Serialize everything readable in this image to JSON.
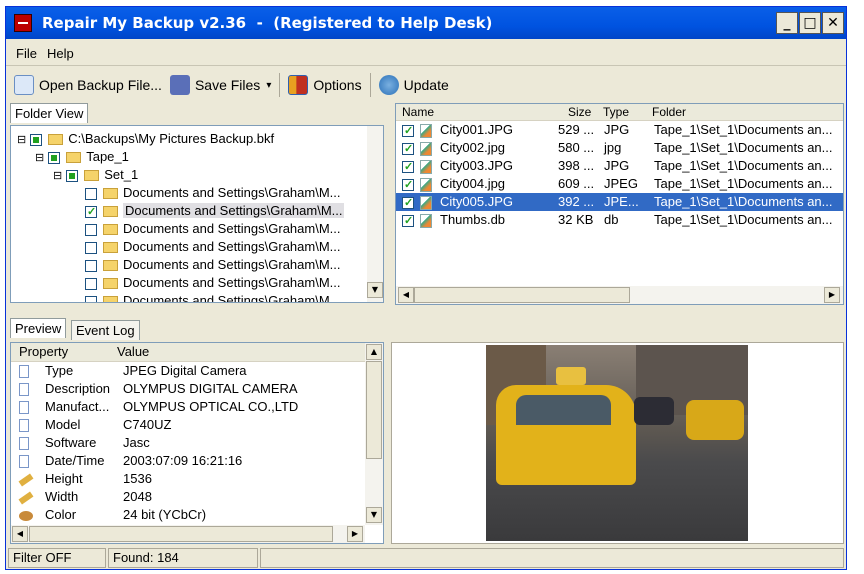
{
  "window": {
    "title": "Repair My Backup v2.36  -  (Registered to Help Desk)",
    "minimize": "_",
    "maximize": "□",
    "close": "✕"
  },
  "menu": [
    "File",
    "Help"
  ],
  "toolbar": {
    "open": "Open Backup File...",
    "save": "Save Files",
    "save_arrow": "▾",
    "options": "Options",
    "update": "Update"
  },
  "folder_view": {
    "tab": "Folder View",
    "tree": [
      {
        "label": "C:\\Backups\\My Pictures Backup.bkf",
        "level": 0,
        "check": "partial",
        "expander": "⊟"
      },
      {
        "label": "Tape_1",
        "level": 1,
        "check": "partial",
        "expander": "⊟"
      },
      {
        "label": "Set_1",
        "level": 2,
        "check": "partial",
        "expander": "⊟"
      },
      {
        "label": "Documents and Settings\\Graham\\M...",
        "level": 3,
        "check": "off"
      },
      {
        "label": "Documents and Settings\\Graham\\M...",
        "level": 3,
        "check": "on",
        "selected": true
      },
      {
        "label": "Documents and Settings\\Graham\\M...",
        "level": 3,
        "check": "off"
      },
      {
        "label": "Documents and Settings\\Graham\\M...",
        "level": 3,
        "check": "off"
      },
      {
        "label": "Documents and Settings\\Graham\\M...",
        "level": 3,
        "check": "off"
      },
      {
        "label": "Documents and Settings\\Graham\\M...",
        "level": 3,
        "check": "off"
      },
      {
        "label": "Documents and Settings\\Graham\\M...",
        "level": 3,
        "check": "off"
      }
    ]
  },
  "files": {
    "columns": [
      "Name",
      "Size",
      "Type",
      "Folder"
    ],
    "rows": [
      {
        "name": "City001.JPG",
        "size": "529 ...",
        "type": "JPG",
        "folder": "Tape_1\\Set_1\\Documents an..."
      },
      {
        "name": "City002.jpg",
        "size": "580 ...",
        "type": "jpg",
        "folder": "Tape_1\\Set_1\\Documents an..."
      },
      {
        "name": "City003.JPG",
        "size": "398 ...",
        "type": "JPG",
        "folder": "Tape_1\\Set_1\\Documents an..."
      },
      {
        "name": "City004.jpg",
        "size": "609 ...",
        "type": "JPEG",
        "folder": "Tape_1\\Set_1\\Documents an..."
      },
      {
        "name": "City005.JPG",
        "size": "392 ...",
        "type": "JPE...",
        "folder": "Tape_1\\Set_1\\Documents an...",
        "selected": true
      },
      {
        "name": "Thumbs.db",
        "size": "32 KB",
        "type": "db",
        "folder": "Tape_1\\Set_1\\Documents an..."
      }
    ]
  },
  "preview": {
    "tabs": [
      "Preview",
      "Event Log"
    ],
    "columns": [
      "Property",
      "Value"
    ],
    "rows": [
      {
        "icon": "document",
        "property": "Type",
        "value": "JPEG Digital Camera"
      },
      {
        "icon": "document",
        "property": "Description",
        "value": "OLYMPUS DIGITAL CAMERA"
      },
      {
        "icon": "document",
        "property": "Manufact...",
        "value": "OLYMPUS OPTICAL CO.,LTD"
      },
      {
        "icon": "document",
        "property": "Model",
        "value": "C740UZ"
      },
      {
        "icon": "document",
        "property": "Software",
        "value": "Jasc"
      },
      {
        "icon": "document",
        "property": "Date/Time",
        "value": "2003:07:09 16:21:16"
      },
      {
        "icon": "ruler",
        "property": "Height",
        "value": "1536"
      },
      {
        "icon": "ruler",
        "property": "Width",
        "value": "2048"
      },
      {
        "icon": "palette",
        "property": "Color",
        "value": "24 bit (YCbCr)"
      }
    ]
  },
  "status": {
    "filter": "Filter OFF",
    "found": "Found: 184"
  },
  "colors": {
    "title_bar": "#0054e3",
    "selection": "#316ac5",
    "chrome": "#ece9d8"
  }
}
